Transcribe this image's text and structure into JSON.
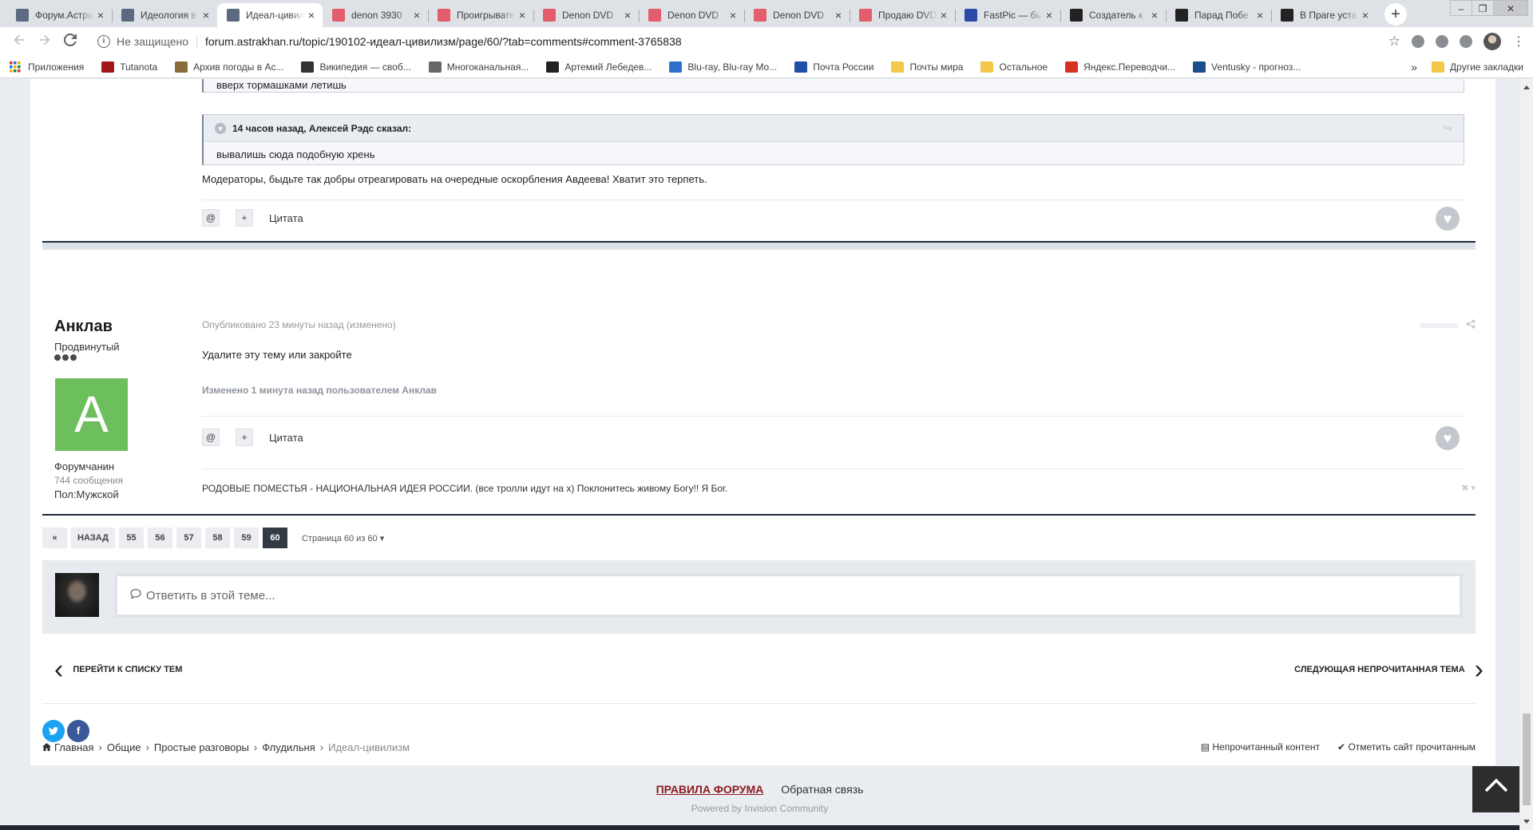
{
  "browser": {
    "tabs": [
      {
        "title": "Форум.Астрахань",
        "fav_color": "#5b6a80",
        "active": false
      },
      {
        "title": "Идеология в",
        "fav_color": "#5b6a80",
        "active": false
      },
      {
        "title": "Идеал-цивилизм",
        "fav_color": "#5b6a80",
        "active": true
      },
      {
        "title": "denon 3930",
        "fav_color": "#e35d6a",
        "active": false
      },
      {
        "title": "Проигрыватель",
        "fav_color": "#e35d6a",
        "active": false
      },
      {
        "title": "Denon DVD",
        "fav_color": "#e35d6a",
        "active": false
      },
      {
        "title": "Denon DVD",
        "fav_color": "#e35d6a",
        "active": false
      },
      {
        "title": "Denon DVD",
        "fav_color": "#e35d6a",
        "active": false
      },
      {
        "title": "Продаю DVD",
        "fav_color": "#e35d6a",
        "active": false
      },
      {
        "title": "FastPic — бы",
        "fav_color": "#2c4aa8",
        "active": false
      },
      {
        "title": "Создатель к",
        "fav_color": "#222222",
        "active": false
      },
      {
        "title": "Парад Побе",
        "fav_color": "#222222",
        "active": false
      },
      {
        "title": "В Праге уста",
        "fav_color": "#222222",
        "active": false
      }
    ],
    "tab_close_glyph": "×",
    "new_tab_glyph": "+",
    "security_label": "Не защищено",
    "url": "forum.astrakhan.ru/topic/190102-идеал-цивилизм/page/60/?tab=comments#comment-3765838",
    "bookmarks": [
      {
        "label": "Приложения",
        "icon": "apps-grid-icon",
        "color": "#d93025"
      },
      {
        "label": "Tutanota",
        "icon": "tutanota-icon",
        "color": "#a01818"
      },
      {
        "label": "Архив погоды в Ас...",
        "icon": "weather-icon",
        "color": "#8a6d3b"
      },
      {
        "label": "Википедия — своб...",
        "icon": "wikipedia-icon",
        "color": "#333333"
      },
      {
        "label": "Многоканальная...",
        "icon": "radio-icon",
        "color": "#666666"
      },
      {
        "label": "Артемий Лебедев...",
        "icon": "lebedev-icon",
        "color": "#222222"
      },
      {
        "label": "Blu-ray, Blu-ray Mo...",
        "icon": "bluray-icon",
        "color": "#2f6fd0"
      },
      {
        "label": "Почта России",
        "icon": "russian-post-icon",
        "color": "#1f4ea8"
      },
      {
        "label": "Почты мира",
        "icon": "folder-icon",
        "color": "#f4c84a"
      },
      {
        "label": "Остальное",
        "icon": "folder-icon",
        "color": "#f4c84a"
      },
      {
        "label": "Яндекс.Переводчи...",
        "icon": "yandex-translate-icon",
        "color": "#d93025"
      },
      {
        "label": "Ventusky - прогноз...",
        "icon": "ventusky-icon",
        "color": "#1a4e8a"
      }
    ],
    "bookmarks_more": "»",
    "other_bookmarks": "Другие закладки"
  },
  "thread": {
    "prev_quote_text": "вверх тормашками летишь",
    "quote": {
      "header": "14 часов назад, Алексей Рэдс сказал:",
      "text": "вывалишь сюда подобную хрень"
    },
    "prev_post_text": "Модераторы, быдьте так добры отреагировать на очередные оскорбления Авдеева! Хватит это терпеть.",
    "quote_button": "Цитата",
    "mention_glyph": "@",
    "plus_glyph": "+"
  },
  "post": {
    "author": "Анклав",
    "rank": "Продвинутый",
    "avatar_letter": "A",
    "avatar_color": "#6cbf5c",
    "group": "Форумчанин",
    "post_count": "744 сообщения",
    "gender": "Пол:Мужской",
    "meta": "Опубликовано 23 минуты назад (изменено)",
    "text": "Удалите эту тему или закройте",
    "edited": "Изменено 1 минута назад пользователем Анклав",
    "signature": "РОДОВЫЕ ПОМЕСТЬЯ - НАЦИОНАЛЬНАЯ ИДЕЯ РОССИИ. (все тролли идут на х) Поклонитесь живому Богу!! Я Бог."
  },
  "pager": {
    "first_glyph": "«",
    "prev": "НАЗАД",
    "pages": [
      "55",
      "56",
      "57",
      "58",
      "59",
      "60"
    ],
    "current": "60",
    "info": "Страница 60 из 60"
  },
  "reply": {
    "placeholder": "Ответить в этой теме..."
  },
  "nav": {
    "prev": "ПЕРЕЙТИ К СПИСКУ ТЕМ",
    "next": "СЛЕДУЮЩАЯ НЕПРОЧИТАННАЯ ТЕМА"
  },
  "breadcrumb": [
    "Главная",
    "Общие",
    "Простые разговоры",
    "Флудильня",
    "Идеал-цивилизм"
  ],
  "footer": {
    "unread": "Непрочитанный контент",
    "mark_read": "Отметить сайт прочитанным",
    "rules": "ПРАВИЛА ФОРУМА",
    "feedback": "Обратная связь",
    "powered": "Powered by Invision Community"
  }
}
